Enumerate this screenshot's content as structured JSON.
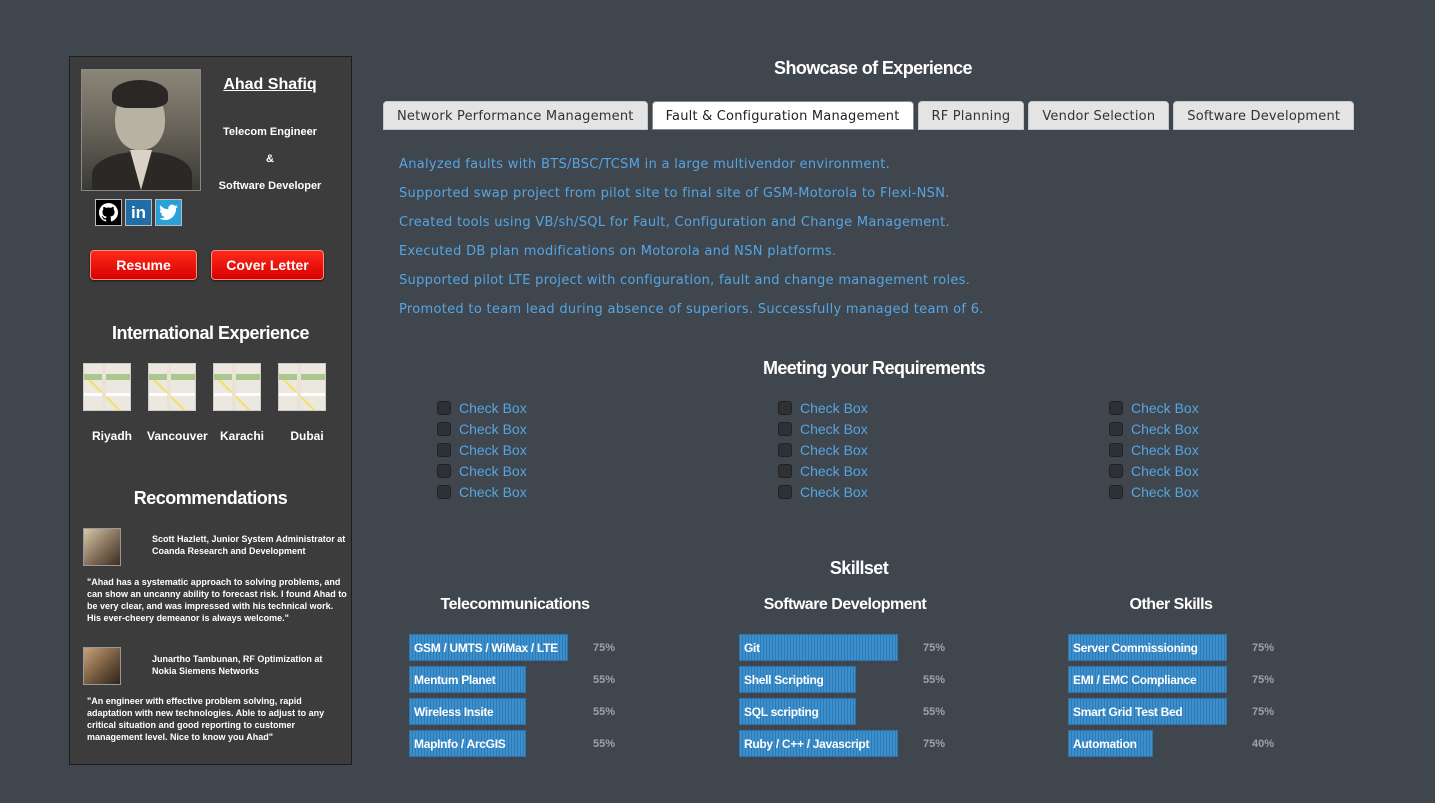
{
  "profile": {
    "name": "Ahad Shafiq",
    "title_line1": "Telecom Engineer",
    "title_amp": "&",
    "title_line2": "Software Developer",
    "social": [
      {
        "icon": "github-icon",
        "glyph": "⌾"
      },
      {
        "icon": "linkedin-icon",
        "glyph": "in"
      },
      {
        "icon": "twitter-icon",
        "glyph": "🐦"
      }
    ],
    "resume_label": "Resume",
    "cover_letter_label": "Cover Letter"
  },
  "international": {
    "heading": "International Experience",
    "cities": [
      "Riyadh",
      "Vancouver",
      "Karachi",
      "Dubai"
    ]
  },
  "recommendations": {
    "heading": "Recommendations",
    "items": [
      {
        "name": "Scott Hazlett, Junior System Administrator at Coanda Research and Development",
        "text": "\"Ahad has a systematic approach to solving problems, and can show an uncanny ability to forecast risk. I found Ahad to be very clear, and was impressed with his technical work. His ever-cheery demeanor is always welcome.\""
      },
      {
        "name": "Junartho Tambunan, RF Optimization at Nokia Siemens Networks",
        "text": "\"An engineer with effective problem solving, rapid adaptation with new technologies. Able to adjust to any critical situation and good reporting to customer management level. Nice to know you Ahad\""
      }
    ]
  },
  "showcase": {
    "heading": "Showcase of Experience",
    "tabs": [
      "Network Performance Management",
      "Fault & Configuration Management",
      "RF Planning",
      "Vendor Selection",
      "Software Development"
    ],
    "active_tab": "Fault & Configuration Management",
    "items": [
      "Analyzed faults with BTS/BSC/TCSM in a large multivendor environment.",
      "Supported swap project from pilot site to final site of GSM-Motorola to Flexi-NSN.",
      "Created tools using VB/sh/SQL for Fault, Configuration and Change Management.",
      "Executed DB plan modifications on Motorola and NSN platforms.",
      "Supported pilot LTE project with configuration, fault and change management roles.",
      "Promoted to team lead during absence of superiors. Successfully managed team of 6."
    ]
  },
  "requirements": {
    "heading": "Meeting your Requirements",
    "columns": [
      [
        "Check Box",
        "Check Box",
        "Check Box",
        "Check Box",
        "Check Box"
      ],
      [
        "Check Box",
        "Check Box",
        "Check Box",
        "Check Box",
        "Check Box"
      ],
      [
        "Check Box",
        "Check Box",
        "Check Box",
        "Check Box",
        "Check Box"
      ]
    ]
  },
  "skillset": {
    "heading": "Skillset",
    "groups": [
      {
        "title": "Telecommunications",
        "skills": [
          {
            "name": "GSM / UMTS / WiMax / LTE",
            "value": 75,
            "label": "75%"
          },
          {
            "name": "Mentum Planet",
            "value": 55,
            "label": "55%"
          },
          {
            "name": "Wireless Insite",
            "value": 55,
            "label": "55%"
          },
          {
            "name": "MapInfo / ArcGIS",
            "value": 55,
            "label": "55%"
          }
        ]
      },
      {
        "title": "Software Development",
        "skills": [
          {
            "name": "Git",
            "value": 75,
            "label": "75%"
          },
          {
            "name": "Shell Scripting",
            "value": 55,
            "label": "55%"
          },
          {
            "name": "SQL scripting",
            "value": 55,
            "label": "55%"
          },
          {
            "name": "Ruby / C++ / Javascript",
            "value": 75,
            "label": "75%"
          }
        ]
      },
      {
        "title": "Other Skills",
        "skills": [
          {
            "name": "Server Commissioning",
            "value": 75,
            "label": "75%"
          },
          {
            "name": "EMI / EMC Compliance",
            "value": 75,
            "label": "75%"
          },
          {
            "name": "Smart Grid Test Bed",
            "value": 75,
            "label": "75%"
          },
          {
            "name": "Automation",
            "value": 40,
            "label": "40%"
          }
        ]
      }
    ]
  },
  "colors": {
    "background": "#40464d",
    "sidebar": "#3c3c3c",
    "link_blue": "#55a5e3",
    "button_red": "#e60000",
    "bar_blue": "#3b8fcd"
  }
}
